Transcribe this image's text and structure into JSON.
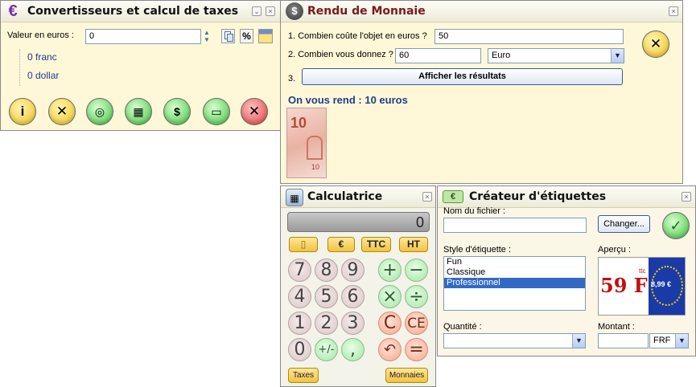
{
  "converter": {
    "title": "Convertisseurs et calcul de taxes",
    "value_label": "Valeur en euros :",
    "value": "0",
    "percent_button": "%",
    "franc": "0 franc",
    "dollar": "0 dollar"
  },
  "change": {
    "title": "Rendu de Monnaie",
    "q1": "1. Combien coûte l'objet en euros ?",
    "q1_value": "50",
    "q2": "2. Combien vous donnez ?",
    "q2_value": "60",
    "currency": "Euro",
    "step3": "3.",
    "show_results": "Afficher les résultats",
    "result": "On vous rend : 10 euros"
  },
  "calculator": {
    "title": "Calculatrice",
    "display": "0",
    "pills": {
      "clip": "",
      "euro": "€",
      "ttc": "TTC",
      "ht": "HT"
    },
    "keys": {
      "k7": "7",
      "k8": "8",
      "k9": "9",
      "plus": "+",
      "minus": "−",
      "k4": "4",
      "k5": "5",
      "k6": "6",
      "times": "×",
      "divide": "÷",
      "k1": "1",
      "k2": "2",
      "k3": "3",
      "c": "C",
      "ce": "CE",
      "k0": "0",
      "sign": "+/-",
      "comma": ",",
      "undo": "↶",
      "equals": "="
    },
    "taxes": "Taxes",
    "monnaies": "Monnaies"
  },
  "labels": {
    "title": "Créateur d'étiquettes",
    "icon_text": "€",
    "filename_label": "Nom du fichier :",
    "filename": "",
    "change_button": "Changer...",
    "style_label": "Style d'étiquette :",
    "styles": [
      "Fun",
      "Classique",
      "Professionnel"
    ],
    "preview_label": "Aperçu :",
    "preview_price": "59 F",
    "preview_ttc": "ttc",
    "preview_euro": "8,99 €",
    "quantity_label": "Quantité :",
    "quantity": "",
    "amount_label": "Montant :",
    "amount": "",
    "amount_currency": "FRF"
  },
  "colors": {
    "window_bg": "#fff8d8",
    "result_blue": "#1d3e8c",
    "selection": "#316ac5",
    "price_red": "#c01010",
    "eu_blue": "#1a3aa8"
  }
}
